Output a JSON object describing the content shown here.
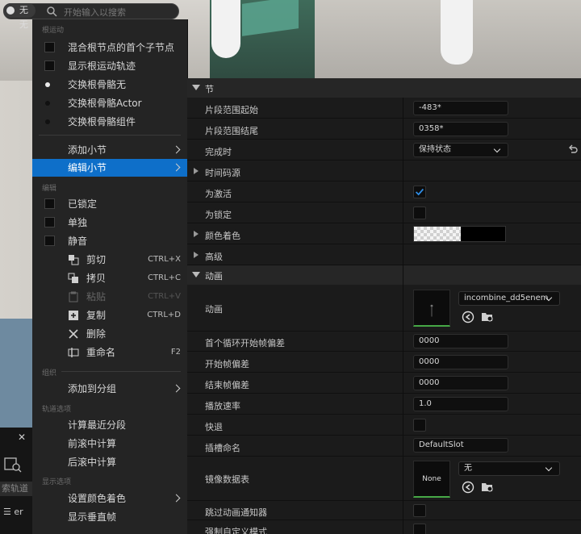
{
  "viewport": {
    "left_pill_label": "无无",
    "search_placeholder": "开始输入以搜索"
  },
  "context_menu": {
    "section_root_motion": "根运动",
    "root_motion_items": [
      {
        "label": "混合根节点的首个子节点",
        "kind": "checkbox",
        "checked": false
      },
      {
        "label": "显示根运动轨迹",
        "kind": "checkbox",
        "checked": false
      },
      {
        "label": "交换根骨骼无",
        "kind": "radio",
        "checked": true
      },
      {
        "label": "交换根骨骼Actor",
        "kind": "radio",
        "checked": false
      },
      {
        "label": "交换根骨骼组件",
        "kind": "radio",
        "checked": false
      }
    ],
    "add_section_label": "添加小节",
    "edit_section_label": "编辑小节",
    "section_edit": "编辑",
    "edit_items": [
      {
        "label": "已锁定",
        "checked": false
      },
      {
        "label": "单独",
        "checked": false
      },
      {
        "label": "静音",
        "checked": false
      }
    ],
    "clipboard_items": [
      {
        "label": "剪切",
        "shortcut": "CTRL+X",
        "icon": "cut-icon",
        "disabled": false
      },
      {
        "label": "拷贝",
        "shortcut": "CTRL+C",
        "icon": "copy-icon",
        "disabled": false
      },
      {
        "label": "粘贴",
        "shortcut": "CTRL+V",
        "icon": "paste-icon",
        "disabled": true
      },
      {
        "label": "复制",
        "shortcut": "CTRL+D",
        "icon": "duplicate-icon",
        "disabled": false
      },
      {
        "label": "删除",
        "shortcut": "",
        "icon": "delete-icon",
        "disabled": false
      },
      {
        "label": "重命名",
        "shortcut": "F2",
        "icon": "rename-icon",
        "disabled": false
      }
    ],
    "section_group": "组织",
    "add_to_group_label": "添加到分组",
    "section_track_options": "轨道选项",
    "track_items": [
      "计算最近分段",
      "前滚中计算",
      "后滚中计算"
    ],
    "section_display_options": "显示选项",
    "set_color_tint_label": "设置颜色着色",
    "show_vertical_frames_label": "显示垂直帧"
  },
  "bottom_left": {
    "search_text": "索轨道",
    "row_text": "er"
  },
  "details": {
    "section_label": "节",
    "rows": {
      "range_start": {
        "label": "片段范围起始",
        "value": "-483*"
      },
      "range_end": {
        "label": "片段范围结尾",
        "value": "0358*"
      },
      "when_finished": {
        "label": "完成时",
        "value": "保持状态"
      },
      "timecode_source": {
        "label": "时间码源"
      },
      "is_active": {
        "label": "为激活",
        "checked": true
      },
      "is_locked": {
        "label": "为锁定",
        "checked": false
      },
      "color_tint": {
        "label": "颜色着色"
      },
      "advanced": {
        "label": "高级"
      }
    },
    "animation_section_label": "动画",
    "anim_rows": {
      "animation": {
        "label": "动画",
        "asset": "incombine_dd5enem"
      },
      "first_loop_offset": {
        "label": "首个循环开始帧偏差",
        "value": "0000"
      },
      "start_offset": {
        "label": "开始帧偏差",
        "value": "0000"
      },
      "end_offset": {
        "label": "结束帧偏差",
        "value": "0000"
      },
      "play_rate": {
        "label": "播放速率",
        "value": "1.0"
      },
      "reverse": {
        "label": "快退",
        "checked": false
      },
      "slot_name": {
        "label": "插槽命名",
        "value": "DefaultSlot"
      },
      "mirror_table": {
        "label": "镜像数据表",
        "thumb": "None",
        "asset": "无"
      },
      "skip_anim_notifiers": {
        "label": "跳过动画通知器",
        "checked": false
      },
      "force_custom_mode": {
        "label": "强制自定义模式",
        "checked": false
      }
    }
  }
}
